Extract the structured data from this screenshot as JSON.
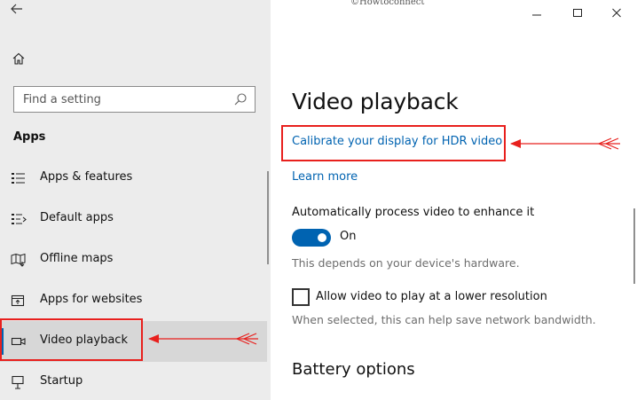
{
  "watermark": "©Howtoconnect",
  "icons": {
    "back": "back-arrow-icon",
    "home": "home-icon",
    "search": "search-icon",
    "minimize": "minimize-icon",
    "maximize": "maximize-icon",
    "close": "close-icon"
  },
  "sidebar": {
    "search_placeholder": "Find a setting",
    "section_heading": "Apps",
    "items": [
      {
        "label": "Apps & features",
        "icon": "apps-features-icon"
      },
      {
        "label": "Default apps",
        "icon": "default-apps-icon"
      },
      {
        "label": "Offline maps",
        "icon": "offline-maps-icon"
      },
      {
        "label": "Apps for websites",
        "icon": "apps-for-websites-icon"
      },
      {
        "label": "Video playback",
        "icon": "video-playback-icon",
        "selected": true
      },
      {
        "label": "Startup",
        "icon": "startup-icon"
      }
    ]
  },
  "main": {
    "title": "Video playback",
    "calibrate_link": "Calibrate your display for HDR video",
    "learn_more_link": "Learn more",
    "auto_process": {
      "label": "Automatically process video to enhance it",
      "state": "On",
      "enabled": true,
      "note": "This depends on your device's hardware."
    },
    "low_resolution": {
      "label": "Allow video to play at a lower resolution",
      "checked": false,
      "note": "When selected, this can help save network bandwidth."
    },
    "battery_heading": "Battery options"
  },
  "colors": {
    "accent": "#0063b1",
    "sidebar_bg": "#ececec",
    "selected_bg": "#d7d7d7",
    "annotation": "#e8201d"
  }
}
